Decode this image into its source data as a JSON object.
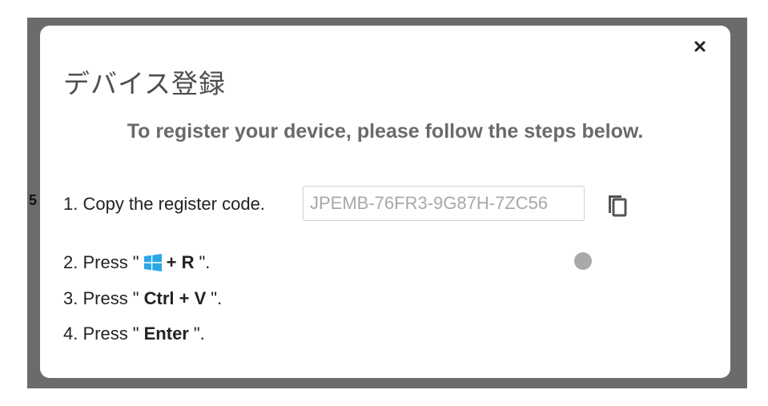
{
  "backdrop": {
    "edge_text": "5"
  },
  "dialog": {
    "title": "デバイス登録",
    "subtitle": "To register your device, please follow the steps below.",
    "close_icon": "close-icon",
    "steps": {
      "step1": {
        "label": "1. Copy the register code.",
        "code_value": "JPEMB-76FR3-9G87H-7ZC56",
        "copy_icon": "copy-icon"
      },
      "step2": {
        "prefix": "2. Press \"",
        "icon": "windows-logo-icon",
        "keys": "+ R",
        "suffix": "\"."
      },
      "step3": {
        "prefix": "3. Press \"",
        "keys": "Ctrl + V",
        "suffix": "\"."
      },
      "step4": {
        "prefix": "4. Press \"",
        "keys": "Enter",
        "suffix": "\"."
      }
    }
  },
  "colors": {
    "backdrop": "#6b6b6b",
    "title": "#4d4d4d",
    "subtitle": "#6a6a6a",
    "windows_blue": "#29a8e8"
  }
}
